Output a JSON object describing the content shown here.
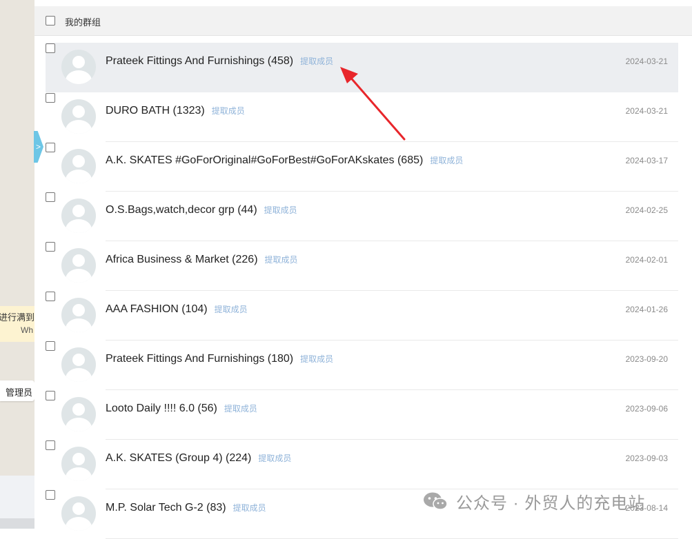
{
  "sidebar_partial": {
    "expand_glyph": ">",
    "notice_line1": "进行满到",
    "notice_line2": "Wh",
    "admin_label": "管理员",
    "expand_icon": "chevron-right-icon"
  },
  "header": {
    "label": "我的群组"
  },
  "groups": [
    {
      "name": "Prateek Fittings And Furnishings (458)",
      "action": "提取成员",
      "date": "2024-03-21"
    },
    {
      "name": "DURO BATH (1323)",
      "action": "提取成员",
      "date": "2024-03-21"
    },
    {
      "name": "A.K. SKATES #GoForOriginal#GoForBest#GoForAKskates (685)",
      "action": "提取成员",
      "date": "2024-03-17"
    },
    {
      "name": "O.S.Bags,watch,decor grp (44)",
      "action": "提取成员",
      "date": "2024-02-25"
    },
    {
      "name": "Africa Business & Market (226)",
      "action": "提取成员",
      "date": "2024-02-01"
    },
    {
      "name": "AAA FASHION (104)",
      "action": "提取成员",
      "date": "2024-01-26"
    },
    {
      "name": "Prateek Fittings And Furnishings (180)",
      "action": "提取成员",
      "date": "2023-09-20"
    },
    {
      "name": "Looto Daily !!!! 6.0 (56)",
      "action": "提取成员",
      "date": "2023-09-06"
    },
    {
      "name": "A.K. SKATES (Group 4) (224)",
      "action": "提取成员",
      "date": "2023-09-03"
    },
    {
      "name": "M.P. Solar Tech G-2 (83)",
      "action": "提取成员",
      "date": "2023-08-14"
    }
  ],
  "watermark": {
    "text": "公众号 · 外贸人的充电站",
    "icon": "wechat-icon"
  },
  "colors": {
    "accent_link": "#8fb3d9",
    "arrow": "#e8262b",
    "highlight_row": "#eceef1"
  }
}
